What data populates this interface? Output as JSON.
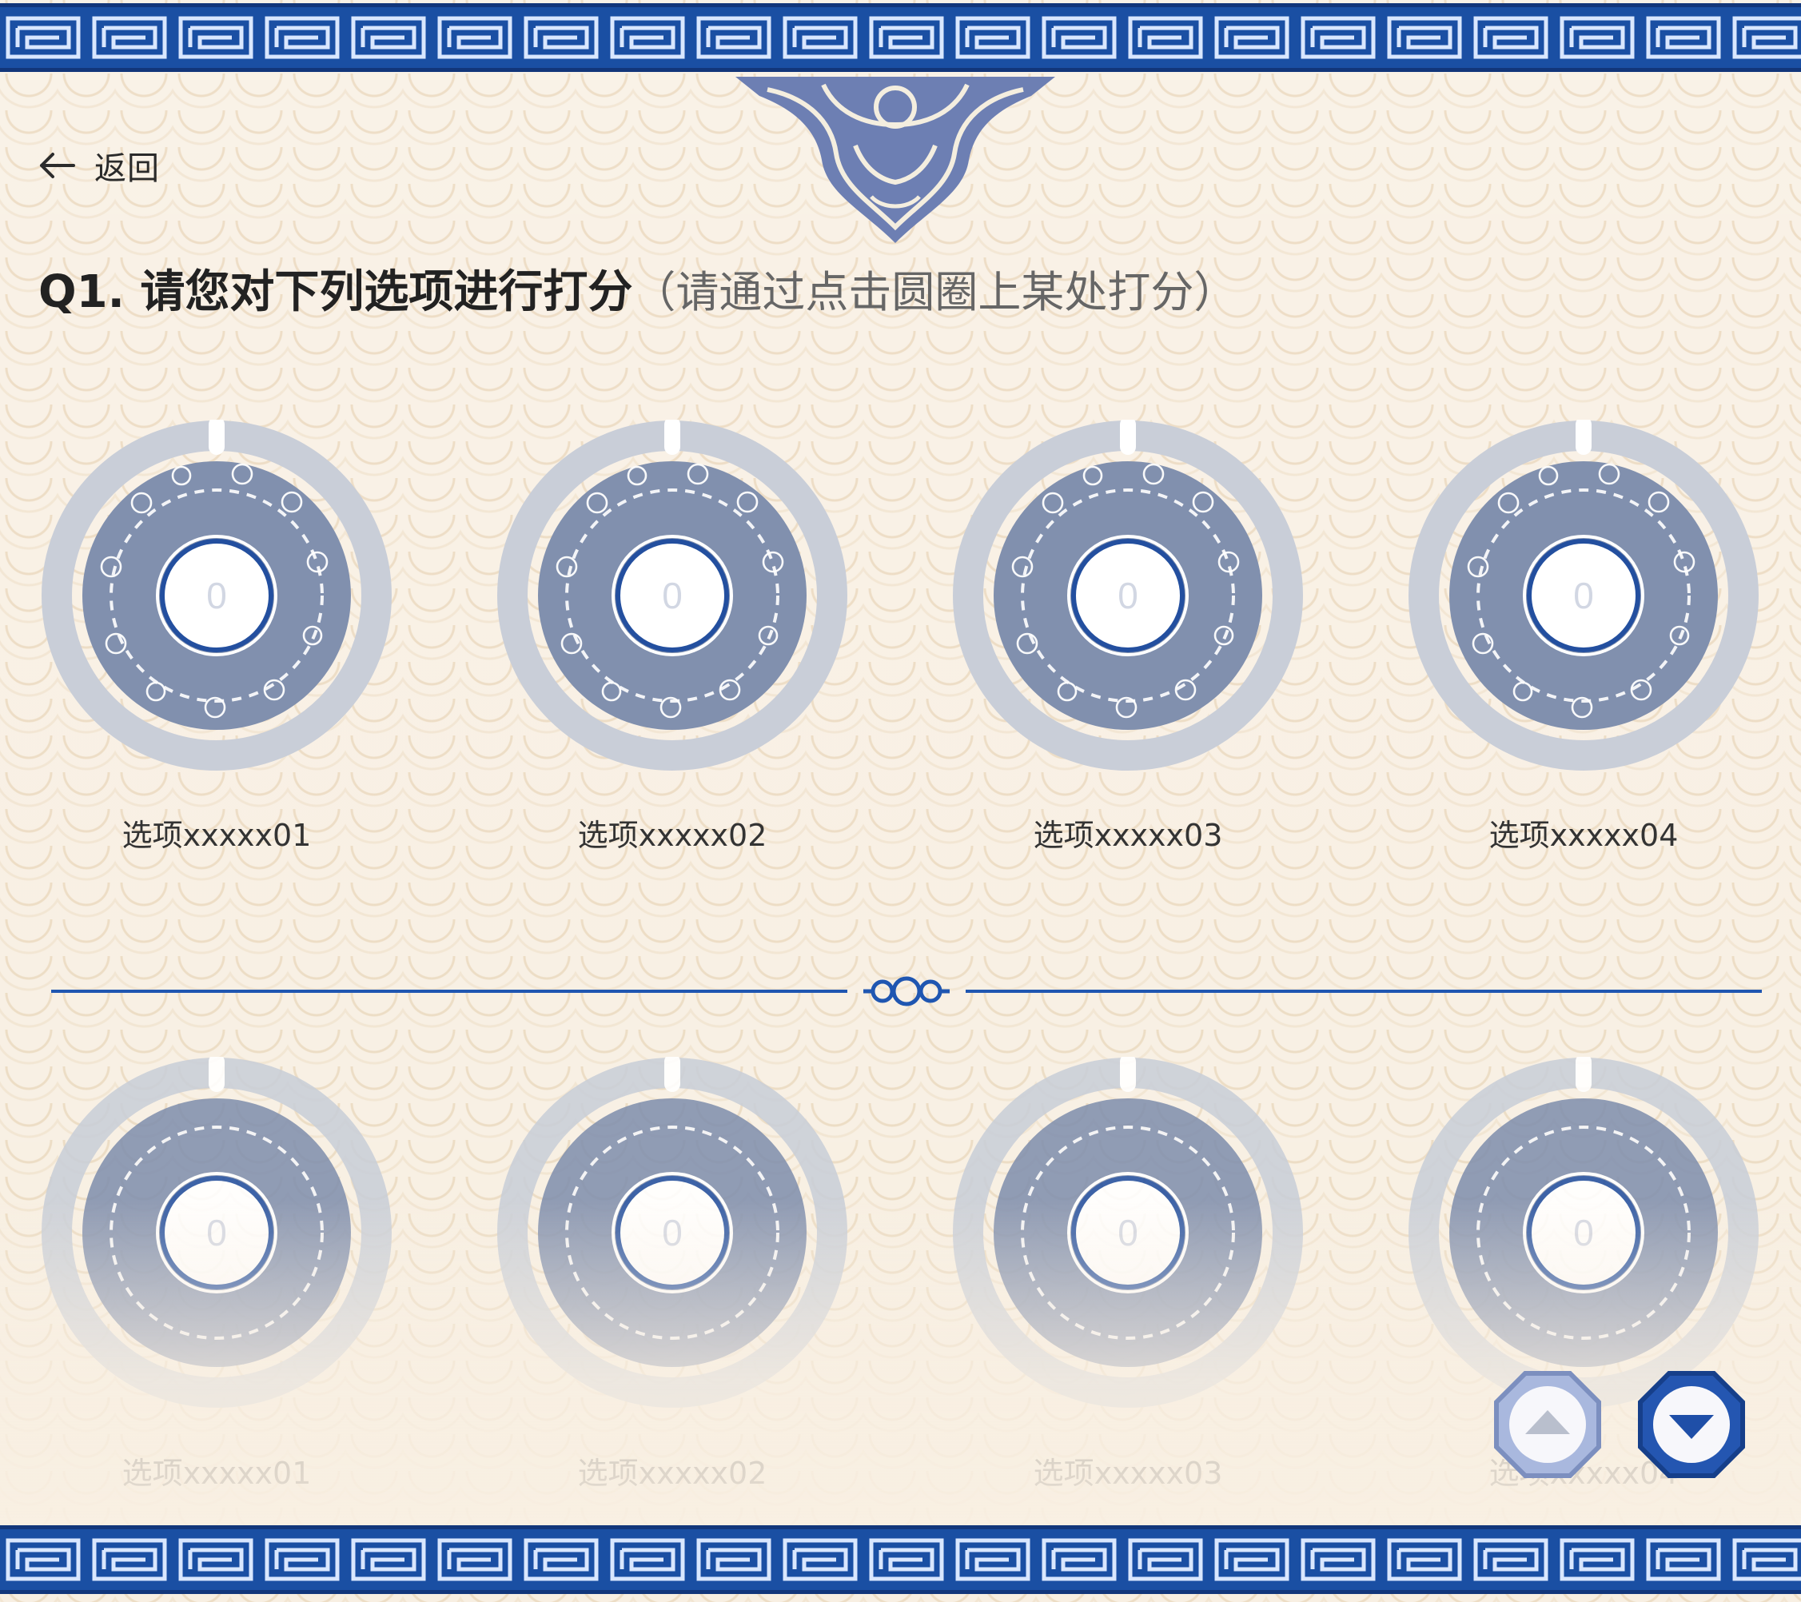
{
  "back": {
    "label": "返回",
    "icon": "arrow-left-icon"
  },
  "question": {
    "title": "Q1. 请您对下列选项进行打分",
    "hint": "（请通过点击圆圈上某处打分）"
  },
  "options_row1": [
    {
      "label": "选项xxxxx01",
      "score": "0"
    },
    {
      "label": "选项xxxxx02",
      "score": "0"
    },
    {
      "label": "选项xxxxx03",
      "score": "0"
    },
    {
      "label": "选项xxxxx04",
      "score": "0"
    }
  ],
  "options_row2": [
    {
      "label": "选项xxxxx01",
      "score": "0"
    },
    {
      "label": "选项xxxxx02",
      "score": "0"
    },
    {
      "label": "选项xxxxx03",
      "score": "0"
    },
    {
      "label": "选项xxxxx04",
      "score": "0"
    }
  ],
  "nav": {
    "up_icon": "chevron-up-icon",
    "down_icon": "chevron-down-icon"
  },
  "colors": {
    "accent_blue": "#1a4fa3",
    "dark_blue": "#12367a",
    "ring_gray": "#c9ced8",
    "disc_blue": "#8190ae",
    "background": "#f8efe2"
  }
}
